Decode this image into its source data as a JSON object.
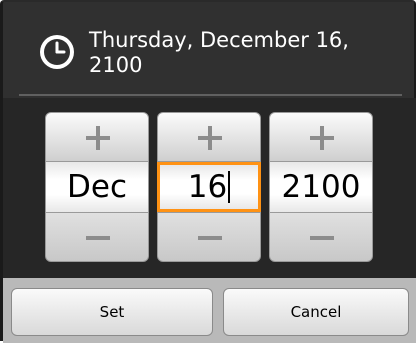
{
  "dialog": {
    "title": "Thursday, December 16, 2100",
    "icon": "clock-icon"
  },
  "picker": {
    "month": "Dec",
    "day": "16",
    "year": "2100",
    "increment_icon": "plus-icon",
    "decrement_icon": "minus-icon"
  },
  "buttons": {
    "set_label": "Set",
    "cancel_label": "Cancel"
  },
  "colors": {
    "focus_accent": "#ff9214",
    "dialog_background": "#303030"
  }
}
